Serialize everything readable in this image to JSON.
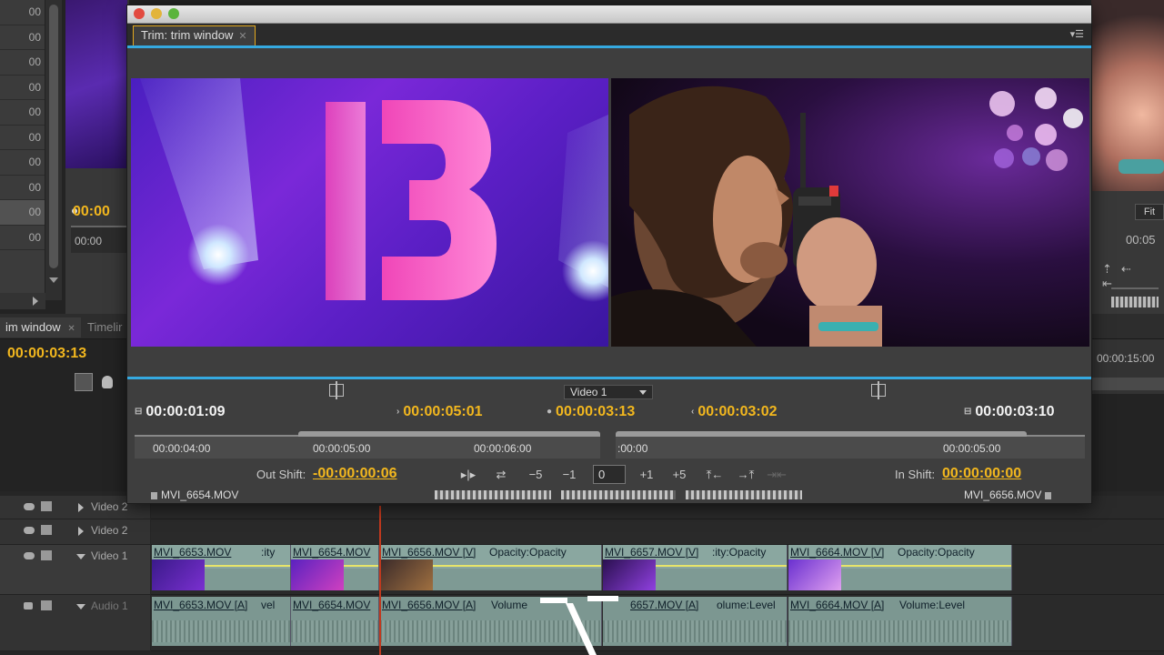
{
  "background": {
    "left_list_values": [
      "00",
      "00",
      "00",
      "00",
      "00",
      "00",
      "00",
      "00",
      "00",
      "00",
      "00"
    ],
    "source_timecode": "00:00",
    "source_ruler_label": "00:00",
    "right_fit_label": "Fit",
    "right_timecode": "00:05",
    "timeline_tabs": [
      "im window",
      "Timelir"
    ],
    "timeline_timecode": "00:00:03:13",
    "timeline_ruler_label": "00:00:15:00"
  },
  "trim_window": {
    "tab_label": "Trim: trim window",
    "video_select": "Video 1",
    "timecodes": {
      "out_duration": "00:00:01:09",
      "out_point": "00:00:05:01",
      "current": "00:00:03:13",
      "in_point": "00:00:03:02",
      "in_duration": "00:00:03:10"
    },
    "ruler_left_labels": [
      "00:00:04:00",
      "00:00:05:00",
      "00:00:06:00"
    ],
    "ruler_right_labels": [
      ":00:00",
      "00:00:05:00"
    ],
    "out_shift_label": "Out Shift:",
    "out_shift_value": "-00:00:00:06",
    "in_shift_label": "In Shift:",
    "in_shift_value": "00:00:00:00",
    "buttons": {
      "minus5": "−5",
      "minus1": "−1",
      "offset": "0",
      "plus1": "+1",
      "plus5": "+5"
    },
    "left_clip": "MVI_6654.MOV",
    "right_clip": "MVI_6656.MOV"
  },
  "tracks": {
    "video_tracks": [
      "Video 2",
      "Video 1"
    ],
    "video_top_partial": "Video 2",
    "audio_track": "Audio 1",
    "video_clips": [
      {
        "name": "MVI_6653.MOV",
        "extra": ":ity"
      },
      {
        "name": "MVI_6654.MOV",
        "extra": ""
      },
      {
        "name": "MVI_6656.MOV [V]",
        "extra": "Opacity:Opacity"
      },
      {
        "name": "MVI_6657.MOV [V]",
        "extra": ":ity:Opacity"
      },
      {
        "name": "MVI_6664.MOV [V]",
        "extra": "Opacity:Opacity"
      }
    ],
    "audio_clips": [
      {
        "name": "MVI_6653.MOV [A]",
        "extra": "vel"
      },
      {
        "name": "MVI_6654.MOV",
        "extra": ""
      },
      {
        "name": "MVI_6656.MOV [A]",
        "extra": "Volume"
      },
      {
        "name": "6657.MOV [A]",
        "extra": "olume:Level"
      },
      {
        "name": "MVI_6664.MOV [A]",
        "extra": "Volume:Level"
      }
    ]
  },
  "colors": {
    "accent_yellow": "#f2b71e",
    "accent_blue": "#35a9e0",
    "clip_teal": "#8aa7a0"
  }
}
